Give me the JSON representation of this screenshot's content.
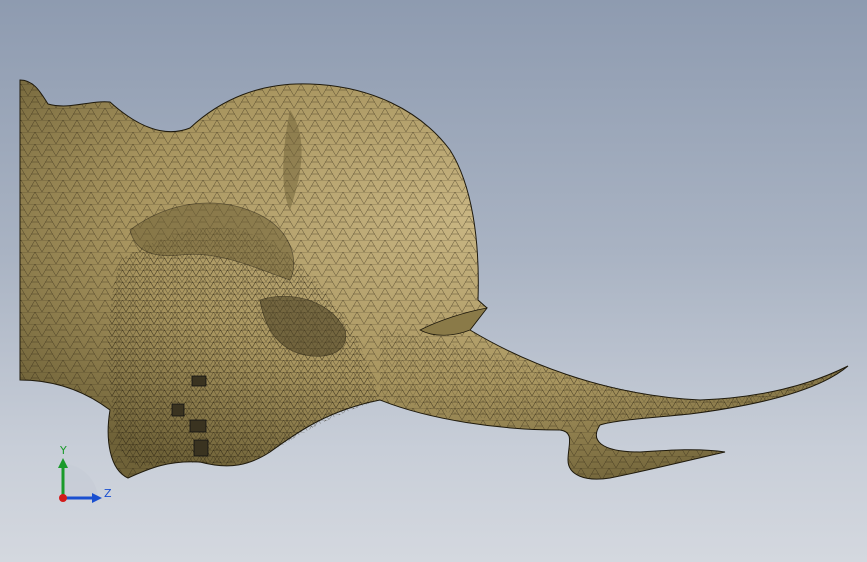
{
  "viewport": {
    "colors": {
      "mesh_fill": "#b3a070",
      "mesh_line": "#2b2412",
      "y_axis": "#1a9a2a",
      "z_axis": "#1a4fd0",
      "x_axis": "#d21a1a"
    }
  },
  "triad": {
    "y_label": "Y",
    "z_label": "Z"
  }
}
